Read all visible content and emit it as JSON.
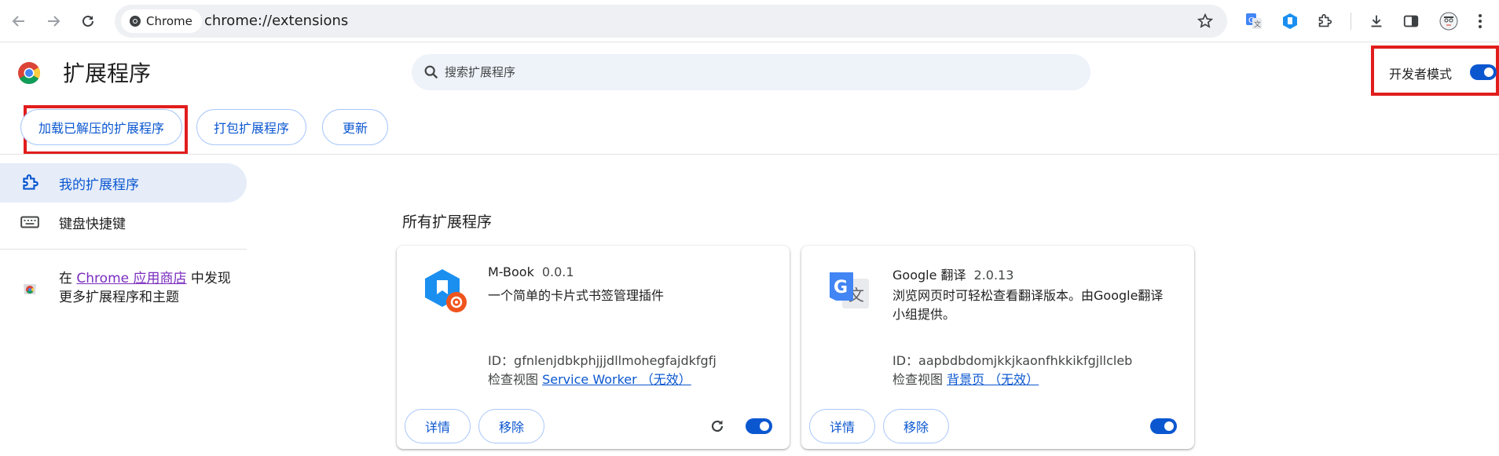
{
  "browser": {
    "site_chip": "Chrome",
    "url": "chrome://extensions"
  },
  "header": {
    "title": "扩展程序",
    "search_placeholder": "搜索扩展程序",
    "dev_mode_label": "开发者模式",
    "dev_mode_on": true
  },
  "actions": {
    "load_unpacked": "加载已解压的扩展程序",
    "pack": "打包扩展程序",
    "update": "更新"
  },
  "sidebar": {
    "items": [
      {
        "label": "我的扩展程序",
        "active": true
      },
      {
        "label": "键盘快捷键",
        "active": false
      }
    ],
    "store_prefix": "在 ",
    "store_link": "Chrome 应用商店",
    "store_suffix": " 中发现更多扩展程序和主题"
  },
  "main": {
    "section_title": "所有扩展程序",
    "extensions": [
      {
        "name": "M-Book",
        "version": "0.0.1",
        "description": "一个简单的卡片式书签管理插件",
        "id_line": "ID：gfnlenjdbkphjjjdllmohegfajdkfgfj",
        "view_label": "检查视图 ",
        "view_link": "Service Worker （无效）",
        "details": "详情",
        "remove": "移除",
        "enabled": true,
        "icon": "m-book-icon"
      },
      {
        "name": "Google 翻译",
        "version": "2.0.13",
        "description": "浏览网页时可轻松查看翻译版本。由Google翻译小组提供。",
        "id_line": "ID：aapbdbdomjkkjkaonfhkkikfgjllcleb",
        "view_label": "检查视图 ",
        "view_link": "背景页 （无效）",
        "details": "详情",
        "remove": "移除",
        "enabled": true,
        "icon": "google-translate-icon"
      }
    ]
  },
  "colors": {
    "accent": "#0b57d0",
    "highlight_box": "#e11d1d",
    "sidebar_active": "#e6edf9"
  }
}
